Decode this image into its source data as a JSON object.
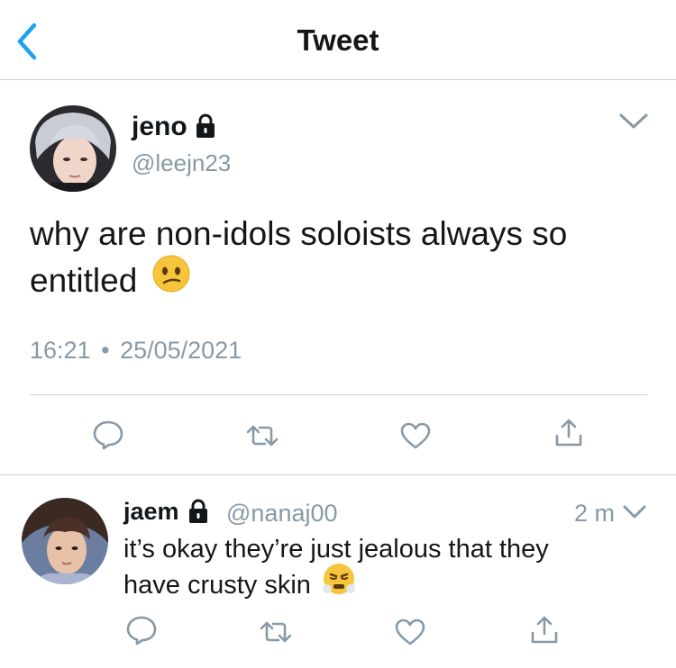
{
  "header": {
    "title": "Tweet"
  },
  "tweet": {
    "name": "jeno",
    "handle": "@leejn23",
    "text_line1": "why are non-idols soloists always so",
    "text_line2": "entitled",
    "emoji": "confused-face",
    "time": "16:21",
    "separator": "•",
    "date": "25/05/2021"
  },
  "reply": {
    "name": "jaem",
    "handle": "@nanaj00",
    "time_ago": "2 m",
    "text_line1": "it’s okay they’re just jealous that they",
    "text_line2": "have crusty skin",
    "emoji": "face-with-steam-from-nose"
  },
  "colors": {
    "accent": "#1da1f2",
    "secondary_text": "#8899a6",
    "divider": "#cfd4d8"
  }
}
